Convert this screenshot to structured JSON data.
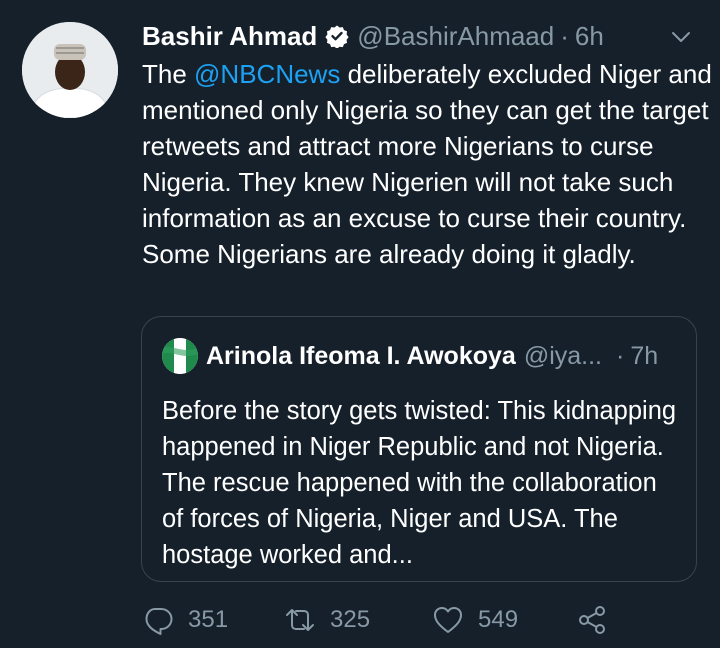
{
  "tweet": {
    "author_name": "Bashir Ahmad",
    "author_handle": "@BashirAhmaad",
    "separator": "·",
    "time": "6h",
    "text_before": "The ",
    "mention": "@NBCNews",
    "text_after": " deliberately excluded Niger and mentioned only Nigeria so they can get the target retweets and attract more Nigerians to curse Nigeria. They knew Nigerien will not take such information as an excuse to curse their country. Some Nigerians are already doing it gladly."
  },
  "quoted_tweet": {
    "author_name": "Arinola Ifeoma I. Awokoya",
    "author_handle": "@iya...",
    "separator": "·",
    "time": "7h",
    "text": "Before the story gets twisted: This kidnapping happened in Niger Republic and not Nigeria. The rescue happened with the collaboration of forces of Nigeria, Niger and USA. The hostage worked and..."
  },
  "actions": {
    "reply_count": "351",
    "retweet_count": "325",
    "like_count": "549"
  },
  "icons": {
    "verified": "verified-badge-icon",
    "caret": "chevron-down-icon",
    "reply": "reply-icon",
    "retweet": "retweet-icon",
    "like": "heart-icon",
    "share": "share-icon"
  },
  "colors": {
    "background": "#15202b",
    "accent": "#1da1f2",
    "secondary_text": "#8899a6",
    "border": "#38444d"
  }
}
